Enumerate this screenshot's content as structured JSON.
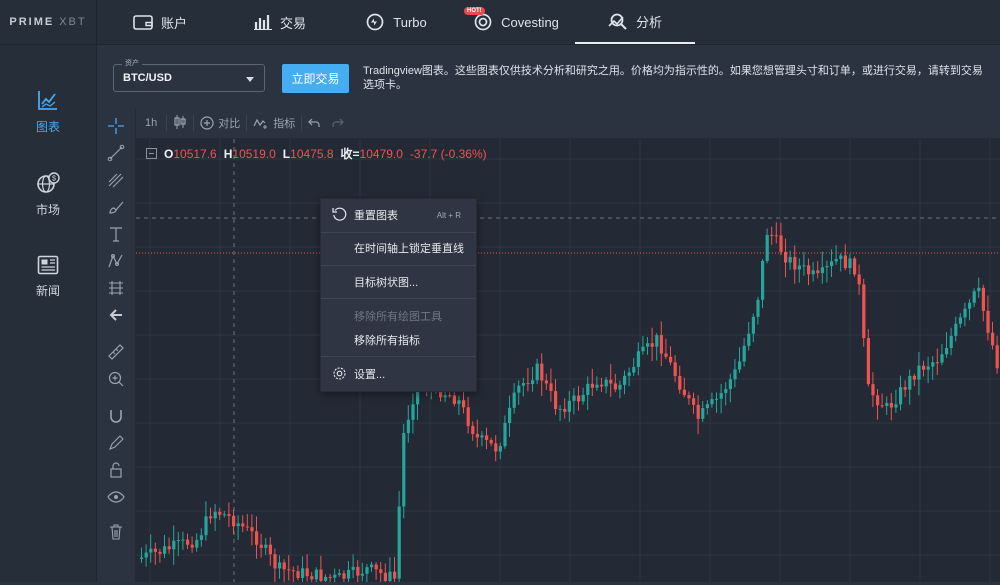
{
  "logo": {
    "bold": "PRIME",
    "light": "XBT"
  },
  "nav": {
    "items": [
      {
        "label": "账户",
        "icon": "account-icon"
      },
      {
        "label": "交易",
        "icon": "bar-chart-icon"
      },
      {
        "label": "Turbo",
        "icon": "turbo-icon"
      },
      {
        "label": "Covesting",
        "icon": "covesting-icon",
        "badge": "HOT!"
      },
      {
        "label": "分析",
        "icon": "analysis-icon",
        "active": true
      }
    ]
  },
  "sidebar": {
    "items": [
      {
        "label": "图表",
        "icon": "chart-icon",
        "active": true
      },
      {
        "label": "市场",
        "icon": "globe-dollar-icon"
      },
      {
        "label": "新闻",
        "icon": "news-icon"
      }
    ]
  },
  "asset": {
    "label": "资产",
    "value": "BTC/USD"
  },
  "trade_button": "立即交易",
  "notice": "Tradingview图表。这些图表仅供技术分析和研究之用。价格均为指示性的。如果您想管理头寸和订单，或进行交易，请转到交易选项卡。",
  "chart_toolbar": {
    "interval": "1h",
    "compare": "对比",
    "indicators": "指标"
  },
  "legend": {
    "o_label": "O",
    "o": "10517.6",
    "h_label": "H",
    "h": "10519.0",
    "l_label": "L",
    "l": "10475.8",
    "c_label": "收=",
    "c": "10479.0",
    "change": "-37.7 (-0.36%)"
  },
  "context_menu": {
    "items": [
      {
        "label": "重置图表",
        "hotkey": "Alt + R",
        "icon": "reset-icon"
      },
      {
        "label": "在时间轴上锁定垂直线"
      },
      {
        "label": "目标树状图..."
      },
      {
        "label": "移除所有绘图工具",
        "disabled": true
      },
      {
        "label": "移除所有指标"
      },
      {
        "label": "设置...",
        "icon": "settings-icon"
      }
    ]
  },
  "colors": {
    "up": "#26a69a",
    "down": "#ef5350",
    "accent": "#45aef0",
    "background": "#242a35"
  }
}
